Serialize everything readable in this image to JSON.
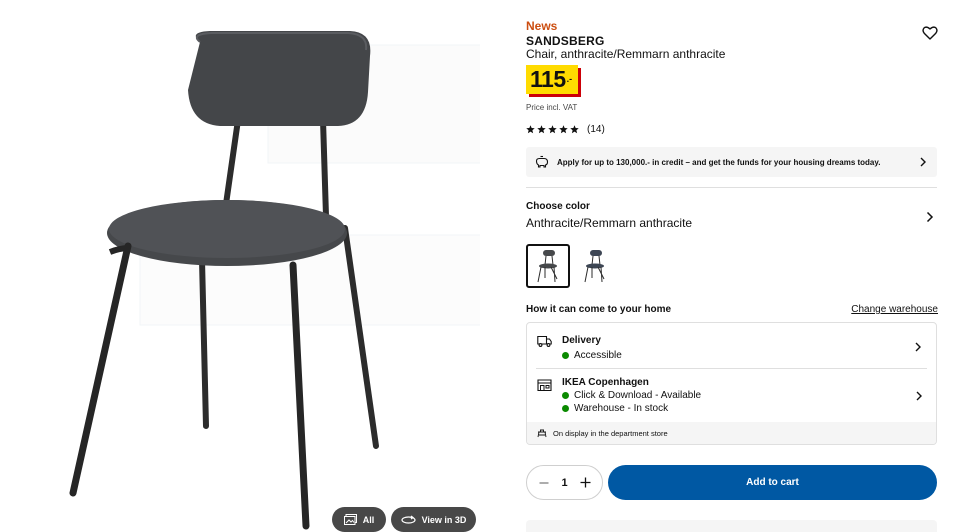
{
  "gallery": {
    "all_label": "All",
    "view3d_label": "View in 3D"
  },
  "product": {
    "badge": "News",
    "name": "SANDSBERG",
    "description": "Chair, anthracite/Remmarn anthracite",
    "price_integer": "115",
    "price_suffix": ".-",
    "price_note": "Price incl. VAT",
    "rating_stars": 5,
    "rating_count": "(14)"
  },
  "credit_banner": {
    "text": "Apply for up to 130,000.- in credit – and get the funds for your housing dreams today."
  },
  "color": {
    "label": "Choose color",
    "value": "Anthracite/Remmarn anthracite"
  },
  "fulfilment": {
    "heading": "How it can come to your home",
    "change_warehouse": "Change warehouse",
    "delivery_title": "Delivery",
    "delivery_status": "Accessible",
    "store_title": "IKEA Copenhagen",
    "store_status_1": "Click & Download - Available",
    "store_status_2": "Warehouse - In stock",
    "display_note": "On display in the department store"
  },
  "cart": {
    "quantity": "1",
    "add_label": "Add to cart"
  },
  "colors": {
    "news": "#cc4e11",
    "price_bg": "#ffdb00",
    "price_shadow": "#cc0008",
    "cart_bg": "#0058a3",
    "stock_dot": "#0a8a00"
  }
}
